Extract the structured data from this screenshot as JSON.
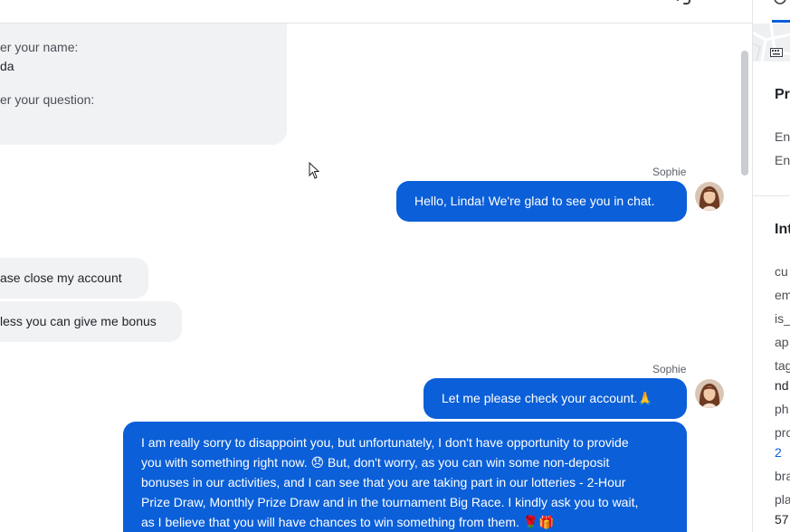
{
  "form": {
    "name_label": "er your name:",
    "name_value": "da",
    "question_label": "er your question:"
  },
  "messages": [
    {
      "sender": "Sophie",
      "text": "Hello, Linda! We're glad to see you in chat."
    },
    {
      "text": "ase close my account"
    },
    {
      "text": "less you can give me bonus"
    },
    {
      "sender": "Sophie",
      "text": "Let me please check your account.🙏"
    },
    {
      "lines": [
        "I am really sorry to disappoint you, but unfortunately, I don't have opportunity to provide",
        "you with something right now. 😞 But, don't worry, as you can win some non-deposit",
        "bonuses in our activities, and I can see that you are taking part in our lotteries - 2-Hour",
        "Prize Draw, Monthly Prize Draw and in the tournament Big Race. I kindly ask you to wait,",
        "as I believe that you will have chances to win something from them. 🌹🎁"
      ]
    }
  ],
  "side_panel": {
    "section1_title": "Pr",
    "section1_items": [
      "En",
      "En"
    ],
    "section2_title": "Int",
    "fields": [
      "cu",
      "em",
      "is_",
      "ap",
      "tag",
      "ph",
      "pro",
      "bra",
      "pla"
    ],
    "tag_value": "nd",
    "pro_value": "2",
    "pla_value": "57"
  },
  "icons": {
    "link": "link-icon",
    "cursor": "mouse-cursor-icon",
    "avatar": "agent-avatar",
    "keyboard": "keyboard-icon"
  },
  "colors": {
    "accent": "#0b5fd8",
    "bubble_in": "#f1f2f4"
  }
}
